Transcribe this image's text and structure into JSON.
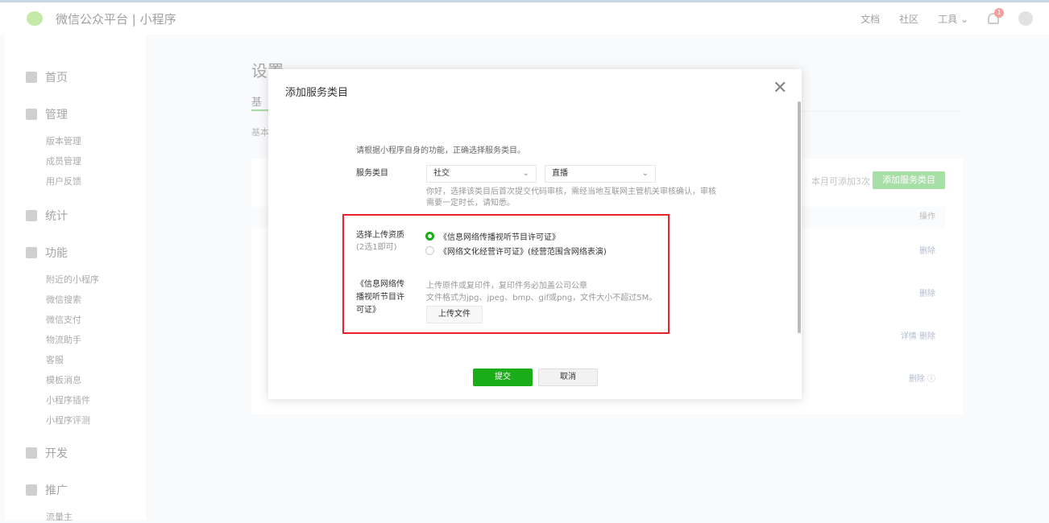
{
  "header": {
    "brand": "微信公众平台 | 小程序",
    "links": [
      "文档",
      "社区",
      "工具 ⌄"
    ],
    "notification_count": "1"
  },
  "sidebar": {
    "home": "首页",
    "manage": "管理",
    "manage_items": [
      "版本管理",
      "成员管理",
      "用户反馈"
    ],
    "stats": "统计",
    "features": "功能",
    "feature_items": [
      "附近的小程序",
      "微信搜索",
      "微信支付",
      "物流助手",
      "客服",
      "模板消息",
      "小程序插件",
      "小程序评测"
    ],
    "dev": "开发",
    "promote": "推广",
    "promote_items": [
      "流量主"
    ]
  },
  "main": {
    "title": "设置",
    "tab": "基",
    "sub": "基本",
    "quota": "本月可添加3次",
    "add_button": "添加服务类目",
    "table_header": "操作",
    "rows": [
      "删除",
      "删除",
      "详情 删除",
      "删除 ⓘ"
    ]
  },
  "modal": {
    "title": "添加服务类目",
    "intro": "请根据小程序自身的功能，正确选择服务类目。",
    "category_label": "服务类目",
    "select1": "社交",
    "select2": "直播",
    "hint": "你好，选择该类目后首次提交代码审核，需经当地互联网主管机关审核确认，审核需要一定时长，请知悉。",
    "qual_label": "选择上传资质",
    "qual_sub": "(2选1即可)",
    "options": [
      {
        "label": "《信息网络传播视听节目许可证》",
        "selected": true
      },
      {
        "label": "《网络文化经营许可证》(经营范围含网络表演)",
        "selected": false
      }
    ],
    "upload_label": "《信息网络传播视听节目许可证》",
    "upload_desc1": "上传原件或复印件，复印件务必加盖公司公章",
    "upload_desc2": "文件格式为jpg、jpeg、bmp、gif或png，文件大小不超过5M。",
    "upload_button": "上传文件",
    "submit": "提交",
    "cancel": "取消"
  }
}
